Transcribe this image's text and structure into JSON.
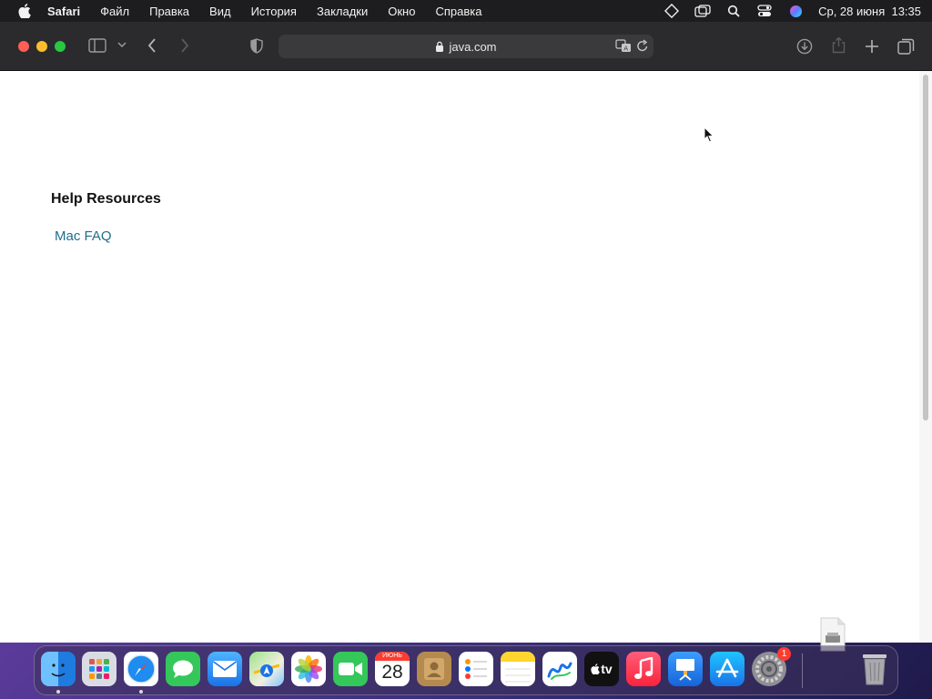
{
  "menubar": {
    "app_name": "Safari",
    "items": [
      "Файл",
      "Правка",
      "Вид",
      "История",
      "Закладки",
      "Окно",
      "Справка"
    ],
    "datetime": "Ср, 28 июня  13:35"
  },
  "browser": {
    "url": "java.com"
  },
  "page": {
    "heading": "Help Resources",
    "link": "Mac FAQ",
    "link_color": "#1f6e8c"
  },
  "dock": {
    "apps": [
      "finder",
      "launchpad",
      "safari",
      "messages",
      "mail",
      "maps",
      "photos",
      "facetime",
      "calendar",
      "contacts",
      "reminders",
      "notes",
      "freeform",
      "tv",
      "music",
      "keynote",
      "app-store",
      "system-settings"
    ],
    "calendar_month": "ИЮНЬ",
    "calendar_day": "28",
    "tv_label": "tv",
    "settings_badge": "1"
  }
}
